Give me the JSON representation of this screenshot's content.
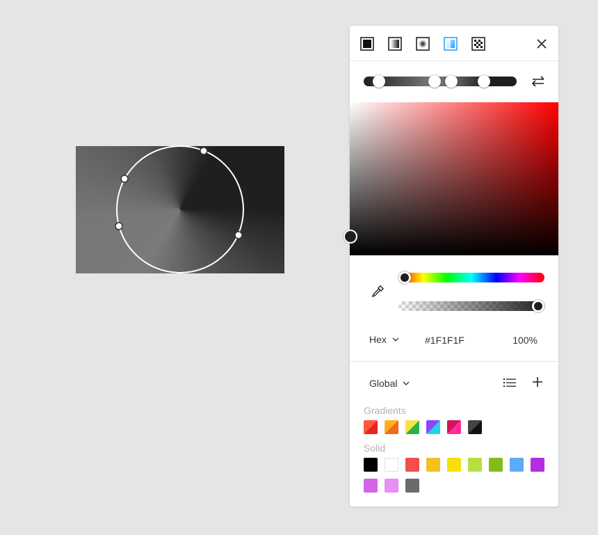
{
  "canvas": {
    "handles": [
      "handle-top",
      "handle-left-upper",
      "handle-left-lower",
      "handle-right"
    ]
  },
  "picker": {
    "types": [
      {
        "name": "solid-fill",
        "active": false
      },
      {
        "name": "linear-gradient",
        "active": false
      },
      {
        "name": "radial-gradient",
        "active": false
      },
      {
        "name": "angular-gradient",
        "active": true
      },
      {
        "name": "image-fill",
        "active": false
      }
    ],
    "gradient_stops": [
      {
        "position": 0.08,
        "color": "#1F1F1F"
      },
      {
        "position": 0.46,
        "color": "#7A7A7A"
      },
      {
        "position": 0.57,
        "color": "#666666"
      },
      {
        "position": 0.79,
        "color": "#1F1F1F"
      }
    ],
    "hue": 0,
    "alpha": 1.0,
    "format": "Hex",
    "hex_value": "#1F1F1F",
    "opacity": "100%",
    "library": "Global",
    "gradients_label": "Gradients",
    "solid_label": "Solid",
    "accent_color": "#18A0FB"
  },
  "gradient_swatches": [
    {
      "from": "#ff5a3c",
      "to": "#e8261f"
    },
    {
      "from": "#ffb020",
      "to": "#f26b1a"
    },
    {
      "from": "#f2e34a",
      "to": "#2bb24c"
    },
    {
      "from": "#8e44ff",
      "to": "#25d0e6"
    },
    {
      "from": "#d4145a",
      "to": "#ff2e9a"
    },
    {
      "from": "#444444",
      "to": "#111111"
    }
  ],
  "solid_swatches": [
    "#000000",
    "#ffffff",
    "#f24e4e",
    "#f5c121",
    "#f5e00b",
    "#b5e13e",
    "#84bb1a",
    "#5aacf5",
    "#b62ddf",
    "#d264e8",
    "#e68ff5",
    "#6b6b6b"
  ]
}
